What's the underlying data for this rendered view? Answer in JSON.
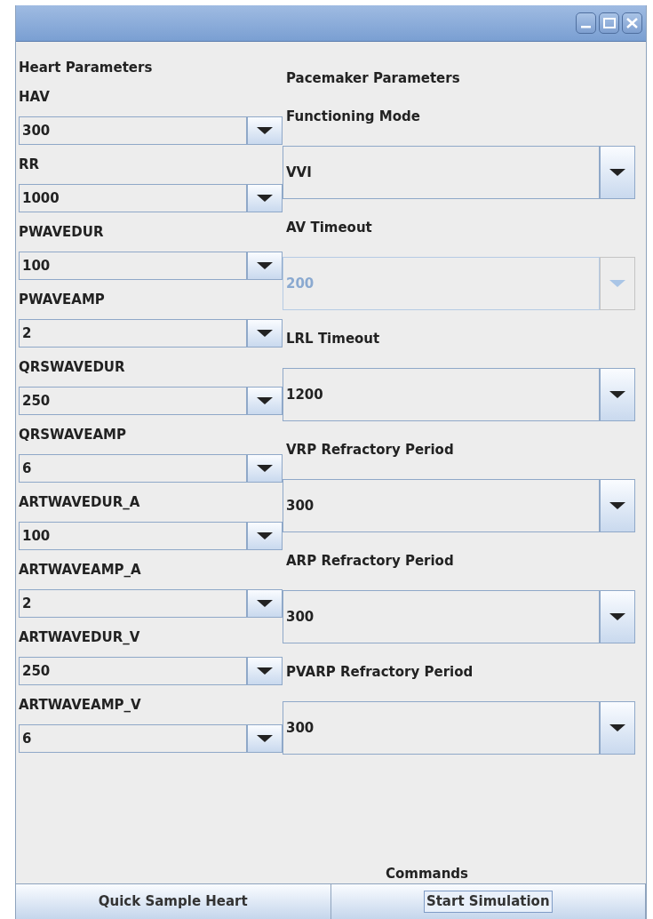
{
  "window": {
    "buttons": [
      {
        "kind": "minimize"
      },
      {
        "kind": "maximize"
      },
      {
        "kind": "close"
      }
    ]
  },
  "heart": {
    "title": "Heart Parameters",
    "fields": [
      {
        "label": "HAV",
        "value": "300"
      },
      {
        "label": "RR",
        "value": "1000"
      },
      {
        "label": "PWAVEDUR",
        "value": "100"
      },
      {
        "label": "PWAVEAMP",
        "value": "2"
      },
      {
        "label": "QRSWAVEDUR",
        "value": "250"
      },
      {
        "label": "QRSWAVEAMP",
        "value": "6"
      },
      {
        "label": "ARTWAVEDUR_A",
        "value": "100"
      },
      {
        "label": "ARTWAVEAMP_A",
        "value": "2"
      },
      {
        "label": "ARTWAVEDUR_V",
        "value": "250"
      },
      {
        "label": "ARTWAVEAMP_V",
        "value": "6"
      }
    ]
  },
  "pacemaker": {
    "title": "Pacemaker Parameters",
    "fields": [
      {
        "label": "Functioning Mode",
        "value": "VVI",
        "disabled": false
      },
      {
        "label": "AV Timeout",
        "value": "200",
        "disabled": true
      },
      {
        "label": "LRL Timeout",
        "value": "1200",
        "disabled": false
      },
      {
        "label": "VRP Refractory Period",
        "value": "300",
        "disabled": false
      },
      {
        "label": "ARP Refractory Period",
        "value": "300",
        "disabled": false
      },
      {
        "label": "PVARP Refractory Period",
        "value": "300",
        "disabled": false
      }
    ]
  },
  "commands": {
    "title": "Commands",
    "buttons": [
      {
        "label": "Quick Sample Heart",
        "focused": false
      },
      {
        "label": "Start Simulation",
        "focused": true
      }
    ]
  }
}
